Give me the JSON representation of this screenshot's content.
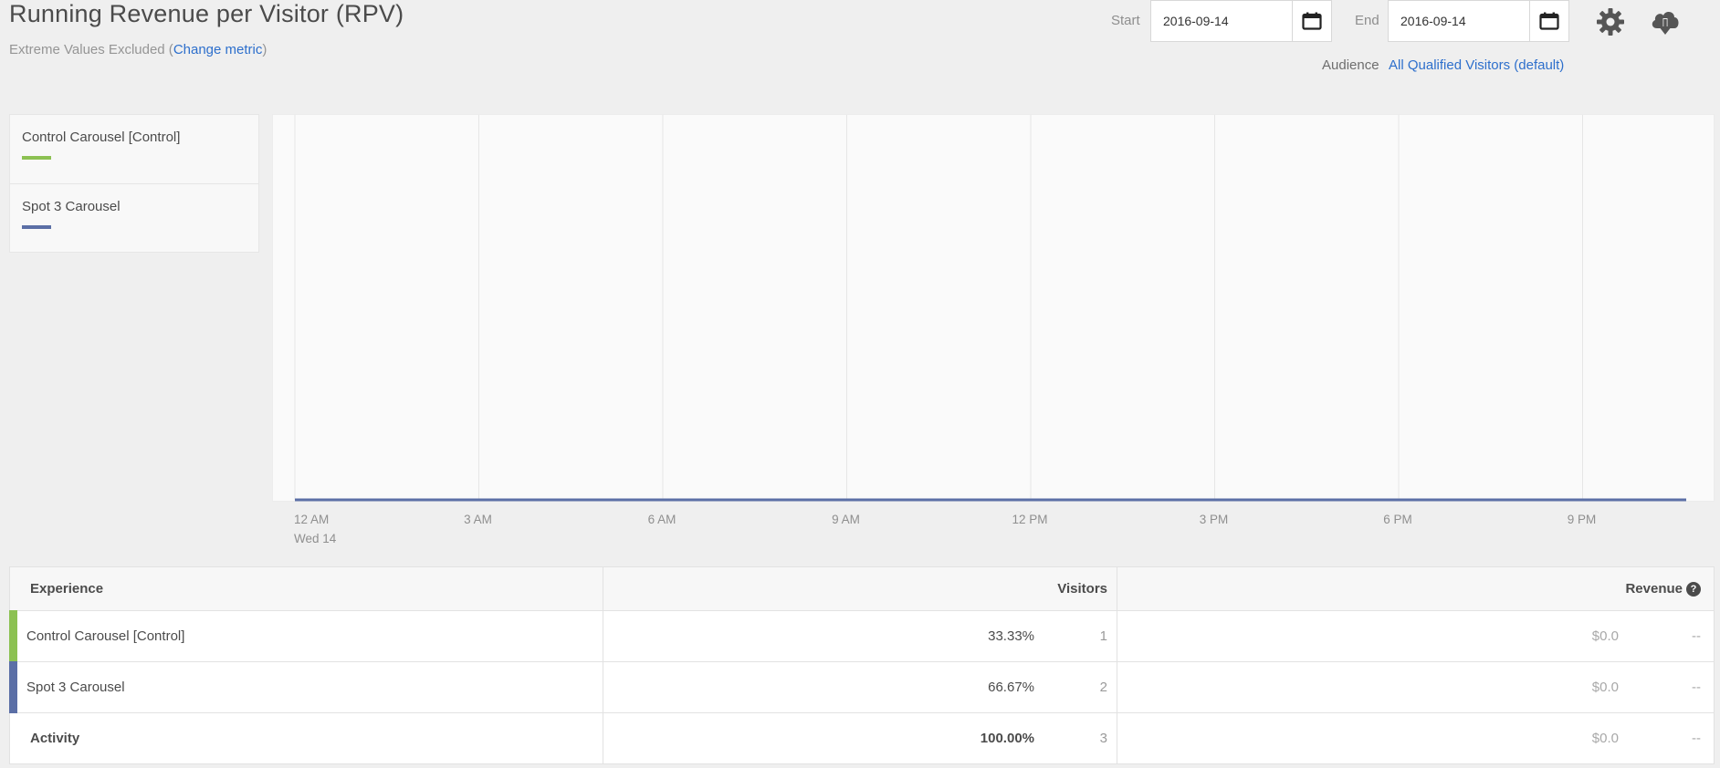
{
  "header": {
    "title": "Running Revenue per Visitor (RPV)",
    "subtitle_prefix": "Extreme Values Excluded (",
    "change_metric": "Change metric",
    "subtitle_suffix": ")"
  },
  "dates": {
    "start_label": "Start",
    "start_value": "2016-09-14",
    "end_label": "End",
    "end_value": "2016-09-14"
  },
  "audience": {
    "label": "Audience",
    "value": "All Qualified Visitors (default)"
  },
  "icons": {
    "calendar": "calendar-icon",
    "settings": "gear-icon",
    "download": "cloud-download-icon",
    "help": "help-icon"
  },
  "legend": [
    {
      "label": "Control Carousel [Control]",
      "color": "#8cc152"
    },
    {
      "label": "Spot 3 Carousel",
      "color": "#5b6fa6"
    }
  ],
  "chart_data": {
    "type": "line",
    "x": [
      "12 AM",
      "3 AM",
      "6 AM",
      "9 AM",
      "12 PM",
      "3 PM",
      "6 PM",
      "9 PM"
    ],
    "x_sublabel": "Wed 14",
    "series": [
      {
        "name": "Control Carousel [Control]",
        "color": "#8cc152",
        "values": [
          0,
          0,
          0,
          0,
          0,
          0,
          0,
          0
        ]
      },
      {
        "name": "Spot 3 Carousel",
        "color": "#5b6fa6",
        "values": [
          0,
          0,
          0,
          0,
          0,
          0,
          0,
          0
        ]
      }
    ],
    "grid": true
  },
  "table": {
    "headers": {
      "experience": "Experience",
      "visitors": "Visitors",
      "revenue": "Revenue",
      "help_glyph": "?"
    },
    "rows": [
      {
        "name": "Control Carousel [Control]",
        "color": "#8cc152",
        "pct": "33.33%",
        "count": "1",
        "revenue": "$0.0",
        "lift": "--"
      },
      {
        "name": "Spot 3 Carousel",
        "color": "#5b6fa6",
        "pct": "66.67%",
        "count": "2",
        "revenue": "$0.0",
        "lift": "--"
      }
    ],
    "total": {
      "name": "Activity",
      "pct": "100.00%",
      "count": "3",
      "revenue": "$0.0",
      "lift": "--"
    }
  }
}
